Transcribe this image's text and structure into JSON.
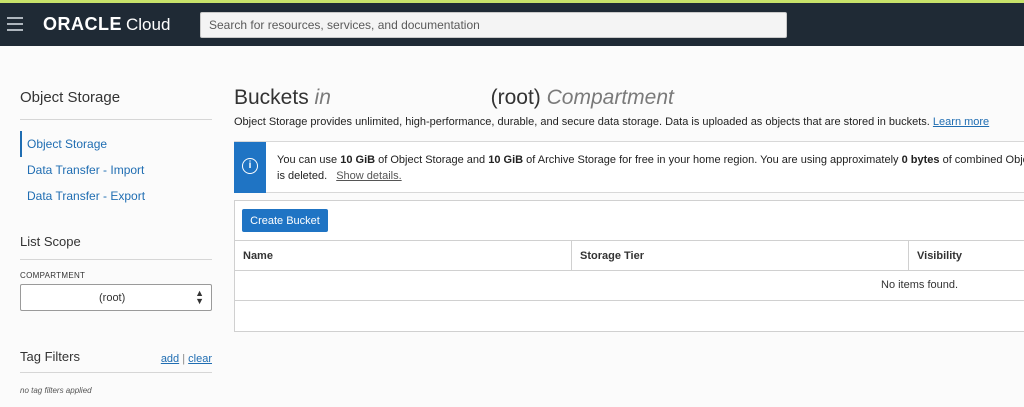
{
  "header": {
    "brand": "ORACLE",
    "product": "Cloud",
    "search_placeholder": "Search for resources, services, and documentation"
  },
  "sidebar": {
    "title": "Object Storage",
    "items": [
      {
        "label": "Object Storage",
        "active": true
      },
      {
        "label": "Data Transfer - Import",
        "active": false
      },
      {
        "label": "Data Transfer - Export",
        "active": false
      }
    ],
    "list_scope": {
      "title": "List Scope",
      "compartment_label": "COMPARTMENT",
      "compartment_value": "(root)"
    },
    "tag_filters": {
      "title": "Tag Filters",
      "add_label": "add",
      "separator": "|",
      "clear_label": "clear",
      "empty_text": "no tag filters applied"
    }
  },
  "main": {
    "title_prefix": "Buckets",
    "title_in": "in",
    "title_root": "(root)",
    "title_suffix": "Compartment",
    "description": "Object Storage provides unlimited, high-performance, durable, and secure data storage. Data is uploaded as objects that are stored in buckets.",
    "learn_more": "Learn more",
    "banner": {
      "line1_a": "You can use",
      "amount1": "10 GiB",
      "line1_b": "of Object Storage and",
      "amount2": "10 GiB",
      "line1_c": "of Archive Storage for free in your home region. You are using approximately",
      "usage": "0 bytes",
      "line1_d": "of combined Object S",
      "line2": "is deleted.",
      "show_details": "Show details."
    },
    "create_button": "Create Bucket",
    "table": {
      "columns": [
        "Name",
        "Storage Tier",
        "Visibility"
      ],
      "empty_text": "No items found."
    }
  },
  "colors": {
    "topbar": "#1f2a35",
    "accent": "#1f74c4",
    "link": "#1f6db2"
  }
}
